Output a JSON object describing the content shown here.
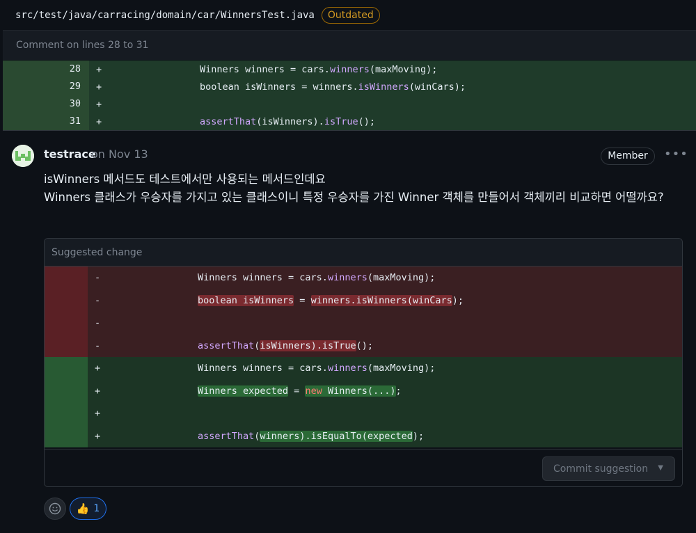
{
  "file": {
    "path": "src/test/java/carracing/domain/car/WinnersTest.java",
    "status_badge": "Outdated",
    "comment_range": "Comment on lines 28 to 31"
  },
  "context_lines": [
    {
      "num": "28",
      "sign": "+",
      "pre": "Winners winners = cars.",
      "fn": "winners",
      "post": "(maxMoving);"
    },
    {
      "num": "29",
      "sign": "+",
      "pre": "boolean isWinners = winners.",
      "fn": "isWinners",
      "post": "(winCars);"
    },
    {
      "num": "30",
      "sign": "+",
      "pre": "",
      "fn": "",
      "post": ""
    },
    {
      "num": "31",
      "sign": "+",
      "pre": "",
      "fn": "assertThat",
      "post": "(isWinners).",
      "fn2": "isTrue",
      "post2": "();"
    }
  ],
  "comment": {
    "author": "testrace",
    "date": "on Nov 13",
    "role_badge": "Member",
    "body_line1": "isWinners 메서드도 테스트에서만 사용되는 메서드인데요",
    "body_line2": "Winners 클래스가 우승자를 가지고 있는 클래스이니 특정 우승자를 가진 Winner 객체를 만들어서 객체끼리 비교하면 어떨까요?"
  },
  "suggestion": {
    "header": "Suggested change",
    "removed": [
      {
        "sign": "-",
        "text": "Winners winners = cars.winners(maxMoving);"
      },
      {
        "sign": "-",
        "text": "boolean isWinners = winners.isWinners(winCars);"
      },
      {
        "sign": "-",
        "text": ""
      },
      {
        "sign": "-",
        "text": "assertThat(isWinners).isTrue();"
      }
    ],
    "added": [
      {
        "sign": "+",
        "text": "Winners winners = cars.winners(maxMoving);"
      },
      {
        "sign": "+",
        "text": "Winners expected = new Winners(...);"
      },
      {
        "sign": "+",
        "text": ""
      },
      {
        "sign": "+",
        "text": "assertThat(winners).isEqualTo(expected);"
      }
    ],
    "commit_button": "Commit suggestion"
  },
  "reactions": {
    "thumbs_up_count": "1",
    "thumbs_up_emoji": "👍"
  },
  "colors": {
    "outdated": "#d29922",
    "added_bg": "#1c3525",
    "removed_bg": "#3a1f22",
    "function": "#d2a8ff",
    "reaction_accent": "#58a6ff"
  }
}
